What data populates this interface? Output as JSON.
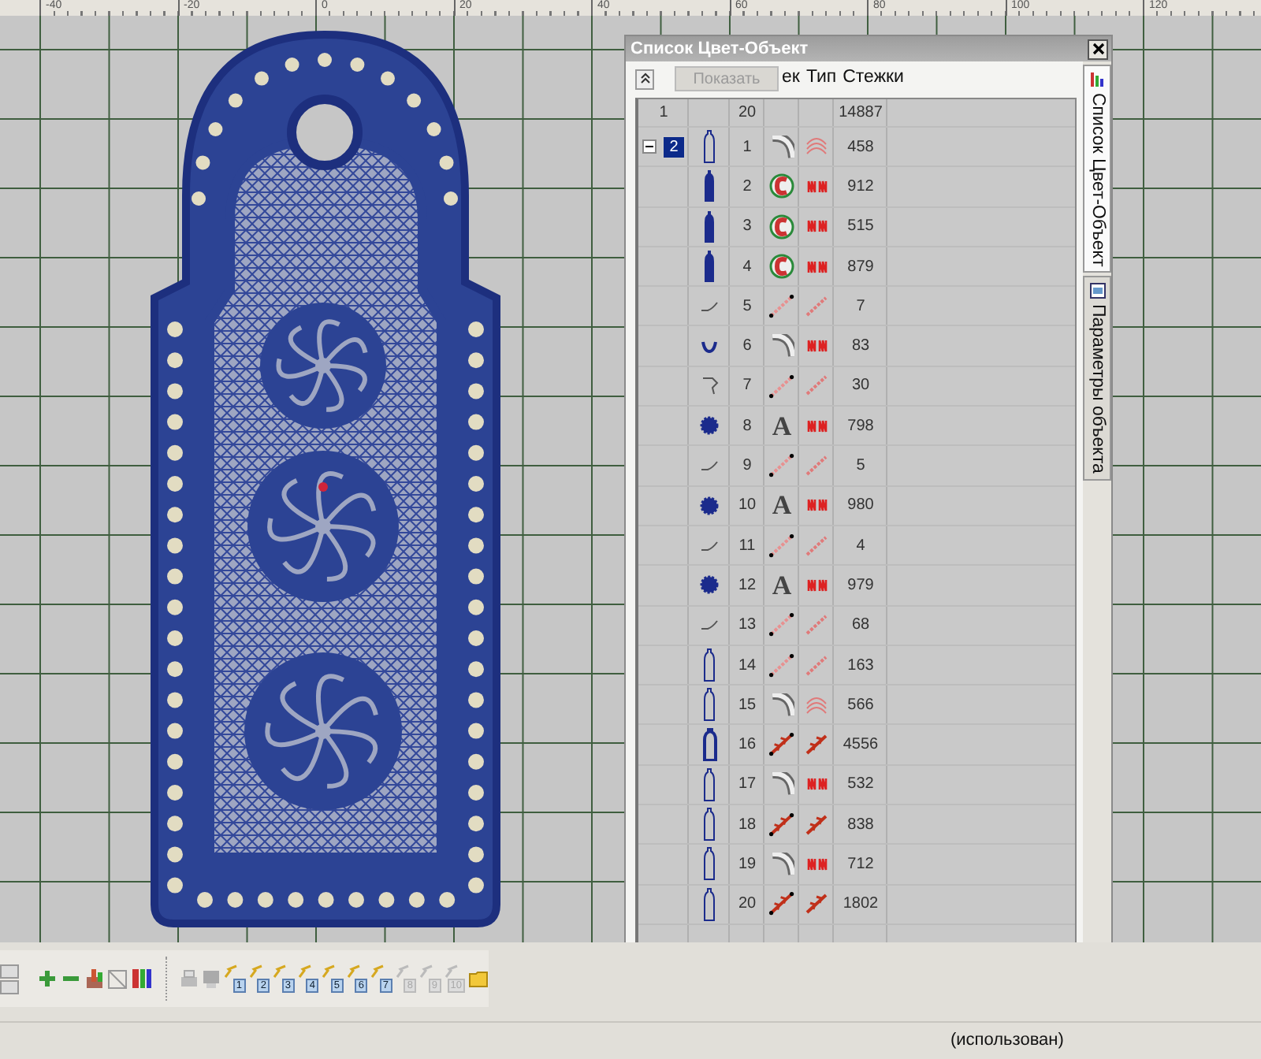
{
  "ruler": {
    "labels": [
      "-40",
      "-20",
      "0",
      "20",
      "40",
      "60",
      "80",
      "100",
      "120"
    ]
  },
  "panel": {
    "title": "Список Цвет-Объект",
    "show_button": {
      "label": "Показать",
      "disabled": true
    },
    "columns": [
      "ек",
      "Тип",
      "Стежки"
    ],
    "totals": {
      "column_1": "1",
      "objects": "20",
      "stitches": "14887"
    },
    "group": {
      "label": "2",
      "expanded": true,
      "selected": true
    },
    "rows": [
      {
        "number": "1",
        "shape": {
          "kind": "outline"
        },
        "object_type": {
          "kind": "curve"
        },
        "stitch_type": {
          "kind": "arcs"
        },
        "stitches": "458"
      },
      {
        "number": "2",
        "shape": {
          "kind": "filled"
        },
        "object_type": {
          "kind": "fill"
        },
        "stitch_type": {
          "kind": "zigzag"
        },
        "stitches": "912"
      },
      {
        "number": "3",
        "shape": {
          "kind": "filled"
        },
        "object_type": {
          "kind": "fill"
        },
        "stitch_type": {
          "kind": "zigzag"
        },
        "stitches": "515"
      },
      {
        "number": "4",
        "shape": {
          "kind": "filled"
        },
        "object_type": {
          "kind": "fill"
        },
        "stitch_type": {
          "kind": "zigzag"
        },
        "stitches": "879"
      },
      {
        "number": "5",
        "shape": {
          "kind": "stroke"
        },
        "object_type": {
          "kind": "line"
        },
        "stitch_type": {
          "kind": "line"
        },
        "stitches": "7"
      },
      {
        "number": "6",
        "shape": {
          "kind": "hook"
        },
        "object_type": {
          "kind": "curve"
        },
        "stitch_type": {
          "kind": "zigzag"
        },
        "stitches": "83"
      },
      {
        "number": "7",
        "shape": {
          "kind": "bracket"
        },
        "object_type": {
          "kind": "line"
        },
        "stitch_type": {
          "kind": "line"
        },
        "stitches": "30"
      },
      {
        "number": "8",
        "shape": {
          "kind": "flower"
        },
        "object_type": {
          "kind": "letter",
          "glyph": "A"
        },
        "stitch_type": {
          "kind": "zigzag"
        },
        "stitches": "798"
      },
      {
        "number": "9",
        "shape": {
          "kind": "stroke"
        },
        "object_type": {
          "kind": "line"
        },
        "stitch_type": {
          "kind": "line"
        },
        "stitches": "5"
      },
      {
        "number": "10",
        "shape": {
          "kind": "flower"
        },
        "object_type": {
          "kind": "letter",
          "glyph": "A"
        },
        "stitch_type": {
          "kind": "zigzag"
        },
        "stitches": "980"
      },
      {
        "number": "11",
        "shape": {
          "kind": "stroke"
        },
        "object_type": {
          "kind": "line"
        },
        "stitch_type": {
          "kind": "line"
        },
        "stitches": "4"
      },
      {
        "number": "12",
        "shape": {
          "kind": "flower"
        },
        "object_type": {
          "kind": "letter",
          "glyph": "A"
        },
        "stitch_type": {
          "kind": "zigzag"
        },
        "stitches": "979"
      },
      {
        "number": "13",
        "shape": {
          "kind": "stroke"
        },
        "object_type": {
          "kind": "line"
        },
        "stitch_type": {
          "kind": "line"
        },
        "stitches": "68"
      },
      {
        "number": "14",
        "shape": {
          "kind": "outline"
        },
        "object_type": {
          "kind": "line"
        },
        "stitch_type": {
          "kind": "line"
        },
        "stitches": "163"
      },
      {
        "number": "15",
        "shape": {
          "kind": "outline"
        },
        "object_type": {
          "kind": "curve"
        },
        "stitch_type": {
          "kind": "arcs"
        },
        "stitches": "566"
      },
      {
        "number": "16",
        "shape": {
          "kind": "thick"
        },
        "object_type": {
          "kind": "arrows"
        },
        "stitch_type": {
          "kind": "arrows"
        },
        "stitches": "4556"
      },
      {
        "number": "17",
        "shape": {
          "kind": "outline"
        },
        "object_type": {
          "kind": "curve"
        },
        "stitch_type": {
          "kind": "zigzag"
        },
        "stitches": "532"
      },
      {
        "number": "18",
        "shape": {
          "kind": "outline"
        },
        "object_type": {
          "kind": "arrows"
        },
        "stitch_type": {
          "kind": "arrows"
        },
        "stitches": "838"
      },
      {
        "number": "19",
        "shape": {
          "kind": "outline"
        },
        "object_type": {
          "kind": "curve"
        },
        "stitch_type": {
          "kind": "zigzag"
        },
        "stitches": "712"
      },
      {
        "number": "20",
        "shape": {
          "kind": "outline"
        },
        "object_type": {
          "kind": "arrows"
        },
        "stitch_type": {
          "kind": "arrows"
        },
        "stitches": "1802"
      }
    ],
    "side_tabs": [
      {
        "label": "Список Цвет-Объект",
        "selected": true
      },
      {
        "label": "Параметры объекта",
        "selected": false
      }
    ]
  },
  "toolbar": {
    "presets": [
      {
        "label": "1",
        "disabled": false
      },
      {
        "label": "2",
        "disabled": false
      },
      {
        "label": "3",
        "disabled": false
      },
      {
        "label": "4",
        "disabled": false
      },
      {
        "label": "5",
        "disabled": false
      },
      {
        "label": "6",
        "disabled": false
      },
      {
        "label": "7",
        "disabled": false
      },
      {
        "label": "8",
        "disabled": true
      },
      {
        "label": "9",
        "disabled": true
      },
      {
        "label": "10",
        "disabled": true
      }
    ]
  },
  "status_bar": {
    "text": "(использован)"
  }
}
